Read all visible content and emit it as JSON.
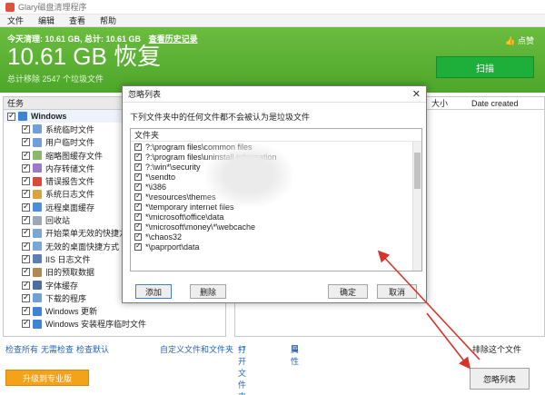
{
  "window": {
    "title": "Glary磁盘清理程序"
  },
  "menu": [
    "文件",
    "编辑",
    "查看",
    "帮助"
  ],
  "banner": {
    "today_text": "今天清理: 10.61 GB, 总计: 10.61 GB",
    "history_link": "查看历史记录",
    "big_text": "10.61 GB 恢复",
    "total_removed": "总计移除 2547 个垃圾文件",
    "like": "点赞",
    "scan_button": "扫描"
  },
  "task_panel": {
    "header": "任务",
    "group": "Windows",
    "items": [
      "系统临时文件",
      "用户临时文件",
      "缩略图缓存文件",
      "内存转储文件",
      "错误报告文件",
      "系统日志文件",
      "远程桌面缓存",
      "回收站",
      "开始菜单无效的快捷方",
      "无效的桌面快捷方式",
      "IIS 日志文件",
      "旧的预取数据",
      "字体缓存",
      "下载的程序",
      "Windows 更新",
      "Windows 安装程序临时文件"
    ]
  },
  "right_panel": {
    "col_size": "大小",
    "col_date": "Date created"
  },
  "bottom_links": {
    "check_all": "检查所有",
    "check_none": "无需检查",
    "check_default": "检查默认",
    "custom": "自定义文件和文件夹",
    "open_folder": "打开文件夹",
    "properties": "属性",
    "exclude": "排除这个文件"
  },
  "upgrade_button": "升级到专业版",
  "ignore_list_button": "忽略列表",
  "dialog": {
    "title": "忽略列表",
    "description": "下列文件夹中的任何文件都不会被认为是垃圾文件",
    "list_header": "文件夹",
    "entries": [
      "?:\\program files\\common files",
      "?:\\program files\\uninstall information",
      "?:\\win*\\security",
      "*\\sendto",
      "*\\i386",
      "*\\resources\\themes",
      "*\\temporary internet files",
      "*\\microsoft\\office\\data",
      "*\\microsoft\\money\\*\\webcache",
      "*\\chaos32",
      "*\\paprport\\data"
    ],
    "add": "添加",
    "delete": "删除",
    "ok": "确定",
    "cancel": "取消"
  },
  "colors": {
    "banner_green": "#5cb335",
    "scan_green": "#1eae3a",
    "upgrade_orange": "#f5a21b",
    "arrow_red": "#d9312b"
  }
}
